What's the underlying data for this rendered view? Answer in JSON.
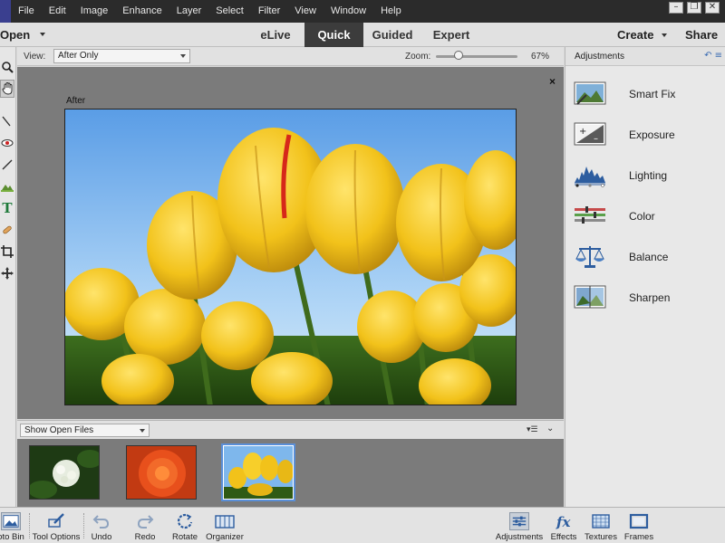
{
  "menubar": {
    "items": [
      "File",
      "Edit",
      "Image",
      "Enhance",
      "Layer",
      "Select",
      "Filter",
      "View",
      "Window",
      "Help"
    ]
  },
  "modebar": {
    "open_label": "Open",
    "tabs": [
      {
        "label": "eLive",
        "active": false
      },
      {
        "label": "Quick",
        "active": true
      },
      {
        "label": "Guided",
        "active": false
      },
      {
        "label": "Expert",
        "active": false
      }
    ],
    "create_label": "Create",
    "share_label": "Share"
  },
  "viewbar": {
    "view_label": "View:",
    "view_value": "After Only",
    "zoom_label": "Zoom:",
    "zoom_value": "67%",
    "zoom_level": 0.67
  },
  "canvas": {
    "after_label": "After",
    "close_symbol": "×"
  },
  "photo_bin": {
    "select_value": "Show Open Files",
    "thumbnails": [
      {
        "subject": "white-hydrangea",
        "selected": false
      },
      {
        "subject": "orange-flower",
        "selected": false
      },
      {
        "subject": "yellow-tulips",
        "selected": true
      }
    ]
  },
  "adjustments": {
    "title": "Adjustments",
    "items": [
      {
        "label": "Smart Fix",
        "icon": "smart-fix-icon"
      },
      {
        "label": "Exposure",
        "icon": "exposure-icon"
      },
      {
        "label": "Lighting",
        "icon": "lighting-icon"
      },
      {
        "label": "Color",
        "icon": "color-icon"
      },
      {
        "label": "Balance",
        "icon": "balance-icon"
      },
      {
        "label": "Sharpen",
        "icon": "sharpen-icon"
      }
    ]
  },
  "taskbar": {
    "left": [
      {
        "label": "oto Bin",
        "icon": "photo-bin-icon",
        "active": true
      },
      {
        "label": "Tool Options",
        "icon": "tool-options-icon",
        "active": false
      },
      {
        "label": "Undo",
        "icon": "undo-icon",
        "active": false
      },
      {
        "label": "Redo",
        "icon": "redo-icon",
        "active": false
      },
      {
        "label": "Rotate",
        "icon": "rotate-icon",
        "active": false
      },
      {
        "label": "Organizer",
        "icon": "organizer-icon",
        "active": false
      }
    ],
    "right": [
      {
        "label": "Adjustments",
        "icon": "adjustments-icon",
        "active": true
      },
      {
        "label": "Effects",
        "icon": "effects-icon",
        "active": false
      },
      {
        "label": "Textures",
        "icon": "textures-icon",
        "active": false
      },
      {
        "label": "Frames",
        "icon": "frames-icon",
        "active": false
      }
    ]
  },
  "colors": {
    "menubar_bg": "#2b2b2b",
    "active_tab_bg": "#3c3c3c",
    "canvas_bg": "#7b7b7b",
    "accent_blue": "#3d6db3",
    "tulip_yellow": "#f2c21a",
    "sky_blue": "#6aa8e8"
  }
}
